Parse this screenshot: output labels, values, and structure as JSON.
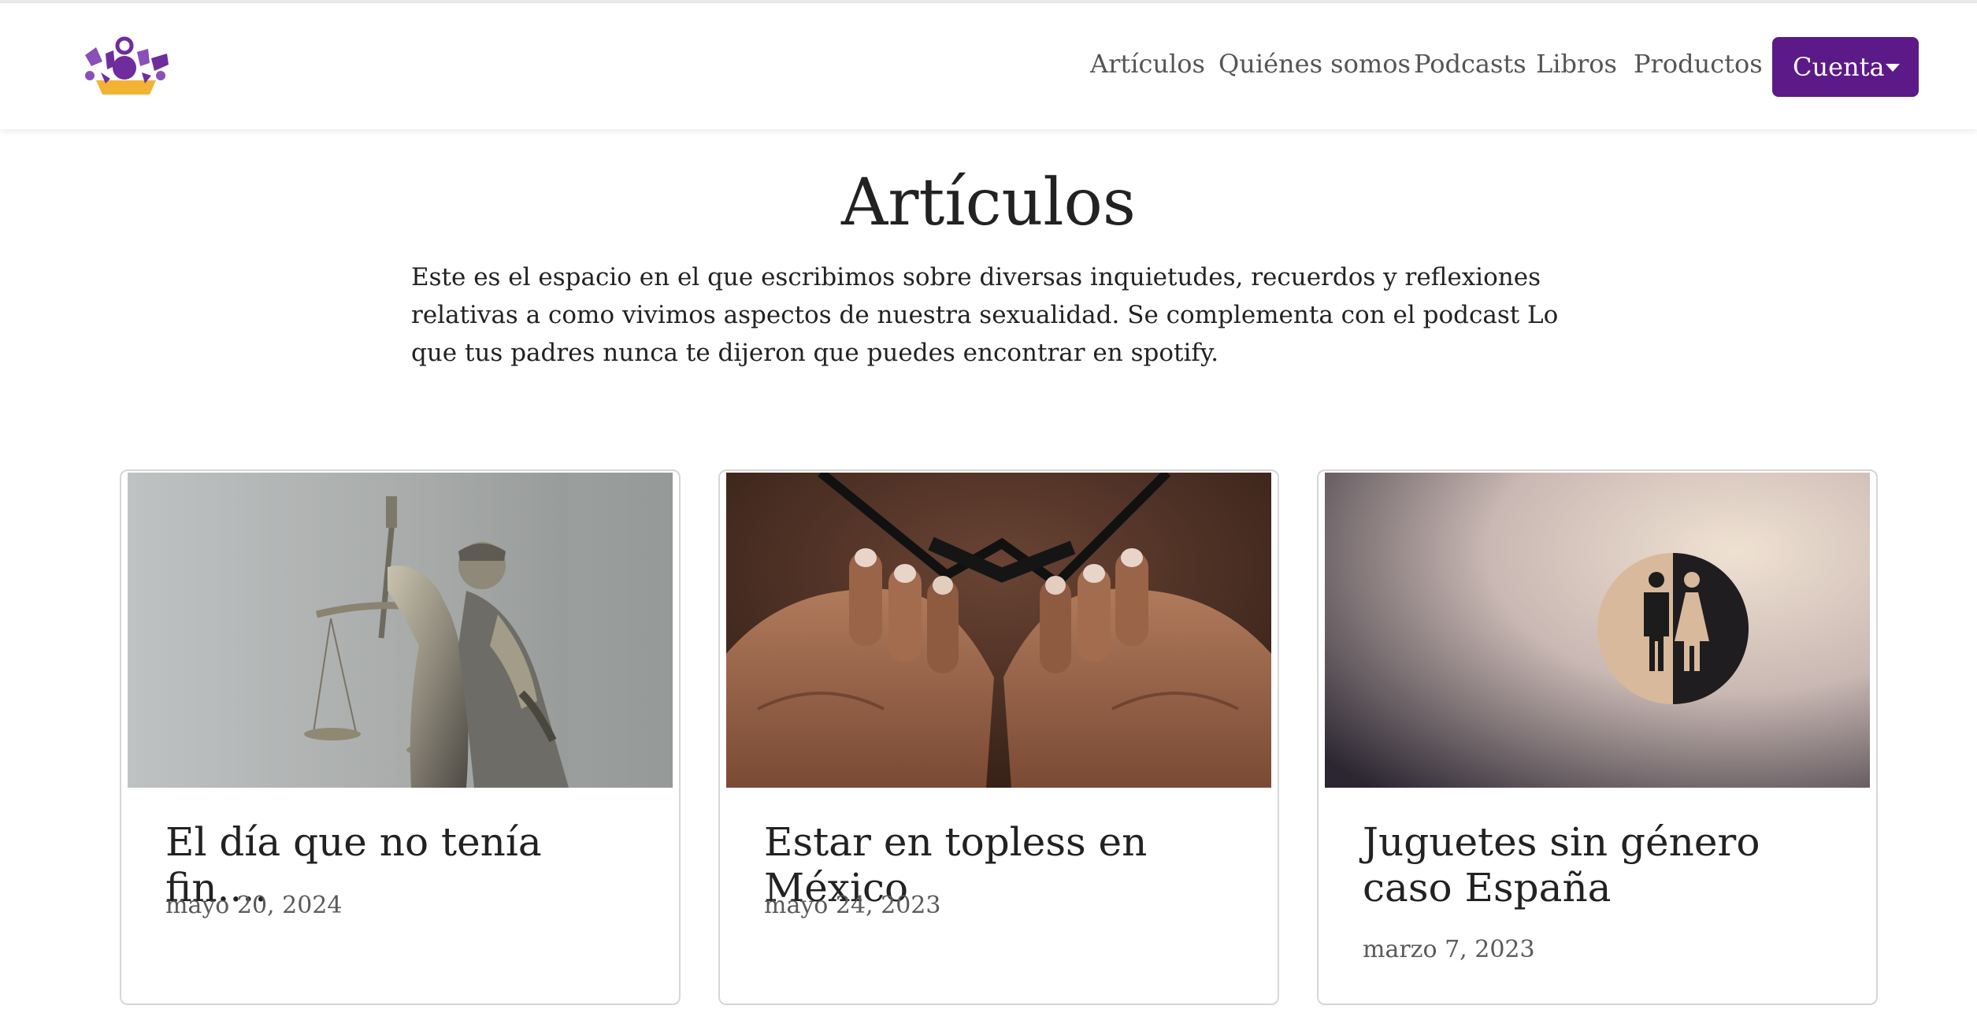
{
  "header": {
    "logo_name": "logo",
    "nav": [
      {
        "label": "Artículos"
      },
      {
        "label": "Quiénes somos"
      },
      {
        "label": "Podcasts"
      },
      {
        "label": "Libros"
      },
      {
        "label": "Productos"
      }
    ],
    "account_button": "Cuenta"
  },
  "main": {
    "title": "Artículos",
    "intro": "Este es el espacio en el que escribimos sobre diversas inquietudes, recuerdos y reflexiones relativas a como vivimos aspectos de nuestra sexualidad. Se complementa con el podcast Lo que tus padres nunca te dijeron que puedes encontrar en spotify."
  },
  "cards": [
    {
      "title": "El día que no tenía fin....",
      "date": "mayo 20, 2024",
      "image": "lady-justice-statue-photo"
    },
    {
      "title": "Estar en topless en México",
      "date": "mayo 24, 2023",
      "image": "hands-holding-bra-photo"
    },
    {
      "title": "Juguetes sin género caso España",
      "date": "marzo 7, 2023",
      "image": "restroom-sign-photo"
    }
  ],
  "colors": {
    "brand_purple": "#5b1a88",
    "logo_yellow": "#f2b233"
  }
}
